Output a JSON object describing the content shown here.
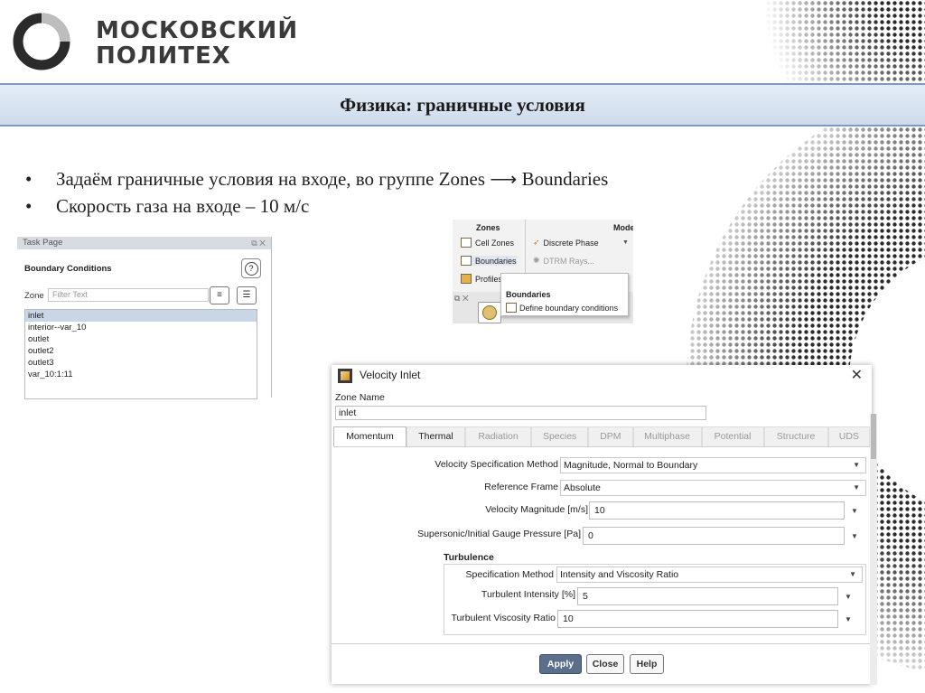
{
  "brand": {
    "line1": "МОСКОВСКИЙ",
    "line2": "ПОЛИТЕХ"
  },
  "slide": {
    "title": "Физика: граничные условия",
    "bullets": [
      "Задаём граничные условия на входе, во группе Zones ⟶ Boundaries",
      "Скорость газа на входе – 10 м/с"
    ]
  },
  "task_page": {
    "header": "Task Page",
    "title": "Boundary Conditions",
    "zone_label": "Zone",
    "filter_placeholder": "Filter Text",
    "zones": [
      "inlet",
      "interior--var_10",
      "outlet",
      "outlet2",
      "outlet3",
      "var_10:1:11"
    ],
    "selected_zone": "inlet"
  },
  "ribbon": {
    "zones_label": "Zones",
    "mode_label": "Mode",
    "cell_zones": "Cell Zones",
    "boundaries": "Boundaries",
    "profiles": "Profiles",
    "discrete_phase": "Discrete Phase",
    "dtrm_rays": "DTRM Rays...",
    "tooltip_title": "Boundaries",
    "tooltip_text": "Define boundary conditions"
  },
  "dialog": {
    "title": "Velocity Inlet",
    "zone_name_label": "Zone Name",
    "zone_name_value": "inlet",
    "tabs": [
      "Momentum",
      "Thermal",
      "Radiation",
      "Species",
      "DPM",
      "Multiphase",
      "Potential",
      "Structure",
      "UDS"
    ],
    "active_tab": "Momentum",
    "velocity_spec_label": "Velocity Specification Method",
    "velocity_spec_value": "Magnitude, Normal to Boundary",
    "ref_frame_label": "Reference Frame",
    "ref_frame_value": "Absolute",
    "velocity_mag_label": "Velocity Magnitude [m/s]",
    "velocity_mag_value": "10",
    "gauge_label": "Supersonic/Initial Gauge Pressure [Pa]",
    "gauge_value": "0",
    "turbulence_label": "Turbulence",
    "spec_method_label": "Specification Method",
    "spec_method_value": "Intensity and Viscosity Ratio",
    "turb_intensity_label": "Turbulent Intensity [%]",
    "turb_intensity_value": "5",
    "turb_visc_label": "Turbulent Viscosity Ratio",
    "turb_visc_value": "10",
    "buttons": {
      "apply": "Apply",
      "close": "Close",
      "help": "Help"
    }
  },
  "colors": {
    "title_band": "#d6e0ee",
    "title_border": "#7c9ac3",
    "apply_button": "#5b6f8a",
    "selected_row": "#c8d6e8"
  }
}
